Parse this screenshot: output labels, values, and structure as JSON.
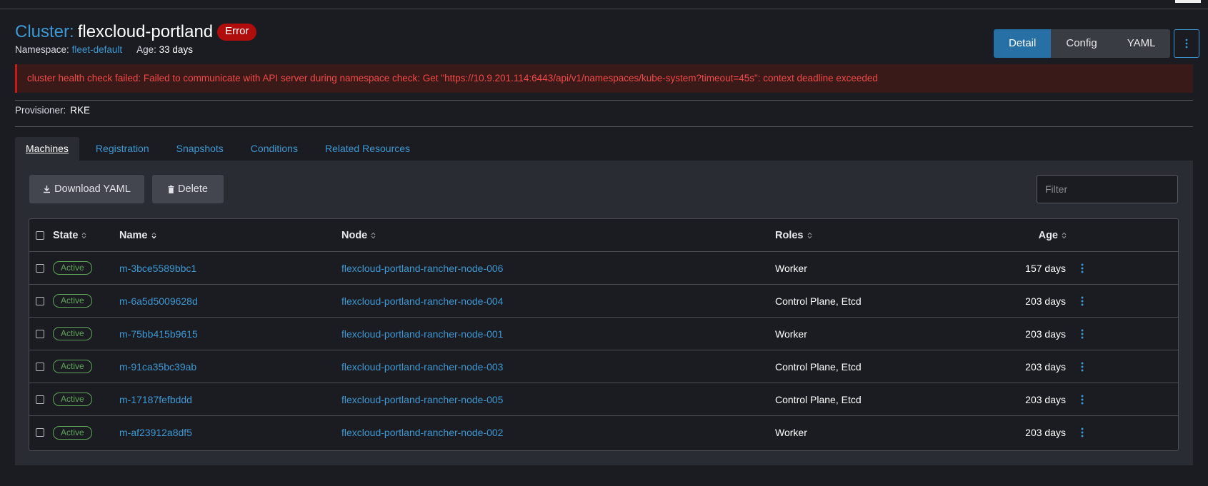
{
  "header": {
    "title_prefix": "Cluster:",
    "title_name": "flexcloud-portland",
    "status": "Error",
    "namespace_label": "Namespace:",
    "namespace_value": "fleet-default",
    "age_label": "Age:",
    "age_value": "33 days"
  },
  "view_tabs": [
    "Detail",
    "Config",
    "YAML"
  ],
  "error_message": "cluster health check failed: Failed to communicate with API server during namespace check: Get \"https://10.9.201.114:6443/api/v1/namespaces/kube-system?timeout=45s\": context deadline exceeded",
  "provisioner": {
    "label": "Provisioner:",
    "value": "RKE"
  },
  "subtabs": [
    "Machines",
    "Registration",
    "Snapshots",
    "Conditions",
    "Related Resources"
  ],
  "toolbar": {
    "download_label": "Download YAML",
    "delete_label": "Delete",
    "filter_placeholder": "Filter"
  },
  "table": {
    "headers": {
      "state": "State",
      "name": "Name",
      "node": "Node",
      "roles": "Roles",
      "age": "Age"
    },
    "rows": [
      {
        "state": "Active",
        "name": "m-3bce5589bbc1",
        "node": "flexcloud-portland-rancher-node-006",
        "roles": "Worker",
        "age": "157 days"
      },
      {
        "state": "Active",
        "name": "m-6a5d5009628d",
        "node": "flexcloud-portland-rancher-node-004",
        "roles": "Control Plane, Etcd",
        "age": "203 days"
      },
      {
        "state": "Active",
        "name": "m-75bb415b9615",
        "node": "flexcloud-portland-rancher-node-001",
        "roles": "Worker",
        "age": "203 days"
      },
      {
        "state": "Active",
        "name": "m-91ca35bc39ab",
        "node": "flexcloud-portland-rancher-node-003",
        "roles": "Control Plane, Etcd",
        "age": "203 days"
      },
      {
        "state": "Active",
        "name": "m-17187fefbddd",
        "node": "flexcloud-portland-rancher-node-005",
        "roles": "Control Plane, Etcd",
        "age": "203 days"
      },
      {
        "state": "Active",
        "name": "m-af23912a8df5",
        "node": "flexcloud-portland-rancher-node-002",
        "roles": "Worker",
        "age": "203 days"
      }
    ]
  },
  "colors": {
    "accent": "#3d98d3",
    "error": "#b00d0d",
    "active_status": "#5fa55a",
    "background": "#1b1c21"
  },
  "icons": {
    "download": "download-icon",
    "delete": "trash-icon",
    "sort": "sort-icon",
    "kebab": "kebab-icon"
  }
}
